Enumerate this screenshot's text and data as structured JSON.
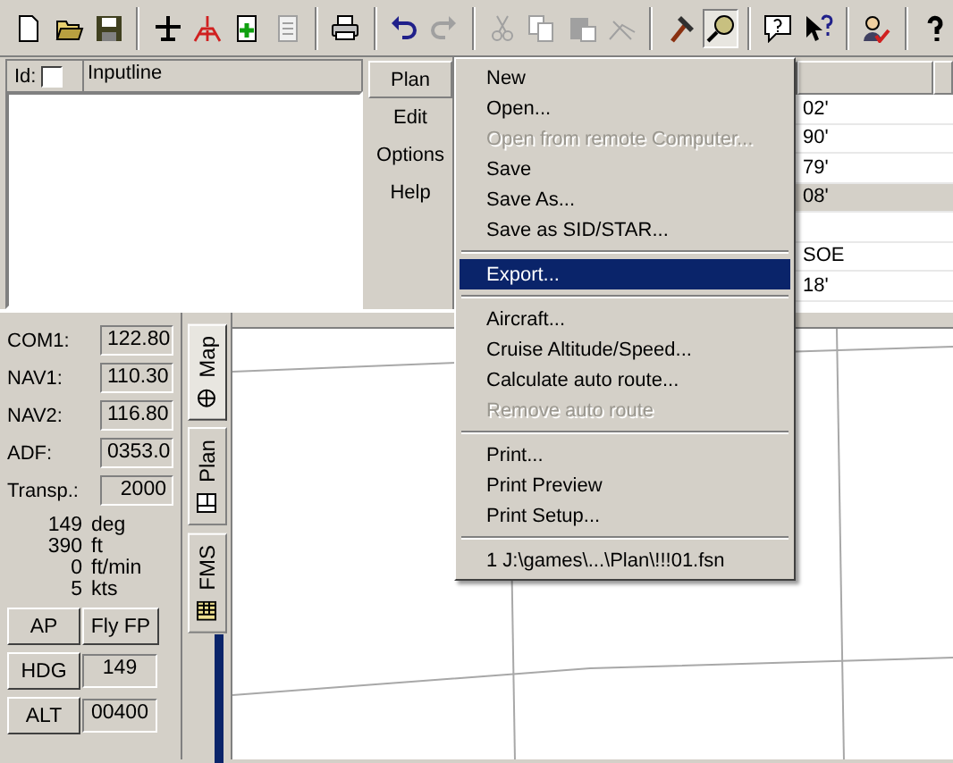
{
  "toolbar": [
    {
      "kind": "new",
      "disabled": false,
      "pressed": false
    },
    {
      "kind": "open",
      "disabled": false,
      "pressed": false
    },
    {
      "kind": "save",
      "disabled": false,
      "pressed": false
    },
    {
      "kind": "separator"
    },
    {
      "kind": "plane",
      "disabled": false,
      "pressed": false
    },
    {
      "kind": "runway",
      "disabled": false,
      "pressed": false
    },
    {
      "kind": "add",
      "disabled": false,
      "pressed": false
    },
    {
      "kind": "list",
      "disabled": true,
      "pressed": false
    },
    {
      "kind": "separator"
    },
    {
      "kind": "print",
      "disabled": false,
      "pressed": false
    },
    {
      "kind": "separator"
    },
    {
      "kind": "undo",
      "disabled": false,
      "pressed": false
    },
    {
      "kind": "redo",
      "disabled": true,
      "pressed": false
    },
    {
      "kind": "separator"
    },
    {
      "kind": "cut",
      "disabled": true,
      "pressed": false
    },
    {
      "kind": "copy",
      "disabled": true,
      "pressed": false
    },
    {
      "kind": "paste",
      "disabled": true,
      "pressed": false
    },
    {
      "kind": "route",
      "disabled": true,
      "pressed": false
    },
    {
      "kind": "separator"
    },
    {
      "kind": "hammer",
      "disabled": false,
      "pressed": false
    },
    {
      "kind": "lens",
      "disabled": false,
      "pressed": true
    },
    {
      "kind": "separator"
    },
    {
      "kind": "helpbubble",
      "disabled": false,
      "pressed": false
    },
    {
      "kind": "whatsthis",
      "disabled": false,
      "pressed": false
    },
    {
      "kind": "separator"
    },
    {
      "kind": "usercheck",
      "disabled": false,
      "pressed": false
    },
    {
      "kind": "separator"
    },
    {
      "kind": "question",
      "disabled": false,
      "pressed": false
    }
  ],
  "input_panel": {
    "id_label": "Id:",
    "id_checked": false,
    "column": "Inputline"
  },
  "side_menu": [
    {
      "label": "Plan",
      "selected": true
    },
    {
      "label": "Edit",
      "selected": false
    },
    {
      "label": "Options",
      "selected": false
    },
    {
      "label": "Help",
      "selected": false
    }
  ],
  "plan_table": {
    "rows": [
      {
        "column_2": "02'",
        "selected": false
      },
      {
        "column_2": "90'",
        "selected": false
      },
      {
        "column_2": "79'",
        "selected": false
      },
      {
        "column_2": "08'",
        "selected": true
      },
      {
        "selected": false
      },
      {
        "column_2": "SOE",
        "selected": false
      },
      {
        "column_2": "18'",
        "selected": false
      }
    ]
  },
  "radios": [
    {
      "label": "COM1:",
      "value": "122.80"
    },
    {
      "label": "NAV1:",
      "value": "110.30"
    },
    {
      "label": "NAV2:",
      "value": "116.80"
    },
    {
      "label": "ADF:",
      "value": "0353.0"
    },
    {
      "label": "Transp.:",
      "value": "2000"
    }
  ],
  "readouts": [
    {
      "value": "149",
      "unit": "deg"
    },
    {
      "value": "390",
      "unit": "ft"
    },
    {
      "value": "0",
      "unit": "ft/min"
    },
    {
      "value": "5",
      "unit": "kts"
    }
  ],
  "autopilot_buttons": [
    "AP",
    "Fly FP"
  ],
  "autopilot_rows": [
    {
      "label": "HDG",
      "value": "149"
    },
    {
      "label": "ALT",
      "value": "00400"
    }
  ],
  "view_tabs": [
    {
      "label": "Map",
      "kind": "globe",
      "selected": true
    },
    {
      "label": "Plan",
      "kind": "plan",
      "selected": false
    },
    {
      "label": "FMS",
      "kind": "grid",
      "selected": false
    }
  ],
  "plan_menu": [
    {
      "kind": "item",
      "label": "New",
      "disabled": false,
      "selected": false
    },
    {
      "kind": "item",
      "label": "Open...",
      "disabled": false,
      "selected": false
    },
    {
      "kind": "item",
      "label": "Open from remote Computer...",
      "disabled": true,
      "selected": false
    },
    {
      "kind": "item",
      "label": "Save",
      "disabled": false,
      "selected": false
    },
    {
      "kind": "item",
      "label": "Save As...",
      "disabled": false,
      "selected": false
    },
    {
      "kind": "item",
      "label": "Save as SID/STAR...",
      "disabled": false,
      "selected": false
    },
    {
      "kind": "separator"
    },
    {
      "kind": "item",
      "label": "Export...",
      "disabled": false,
      "selected": true
    },
    {
      "kind": "separator"
    },
    {
      "kind": "item",
      "label": "Aircraft...",
      "disabled": false,
      "selected": false
    },
    {
      "kind": "item",
      "label": "Cruise Altitude/Speed...",
      "disabled": false,
      "selected": false
    },
    {
      "kind": "item",
      "label": "Calculate auto route...",
      "disabled": false,
      "selected": false
    },
    {
      "kind": "item",
      "label": "Remove auto route",
      "disabled": true,
      "selected": false
    },
    {
      "kind": "separator"
    },
    {
      "kind": "item",
      "label": "Print...",
      "disabled": false,
      "selected": false
    },
    {
      "kind": "item",
      "label": "Print Preview",
      "disabled": false,
      "selected": false
    },
    {
      "kind": "item",
      "label": "Print Setup...",
      "disabled": false,
      "selected": false
    },
    {
      "kind": "separator"
    },
    {
      "kind": "item",
      "label": "1 J:\\games\\...\\Plan\\!!!01.fsn",
      "disabled": false,
      "selected": false
    }
  ]
}
